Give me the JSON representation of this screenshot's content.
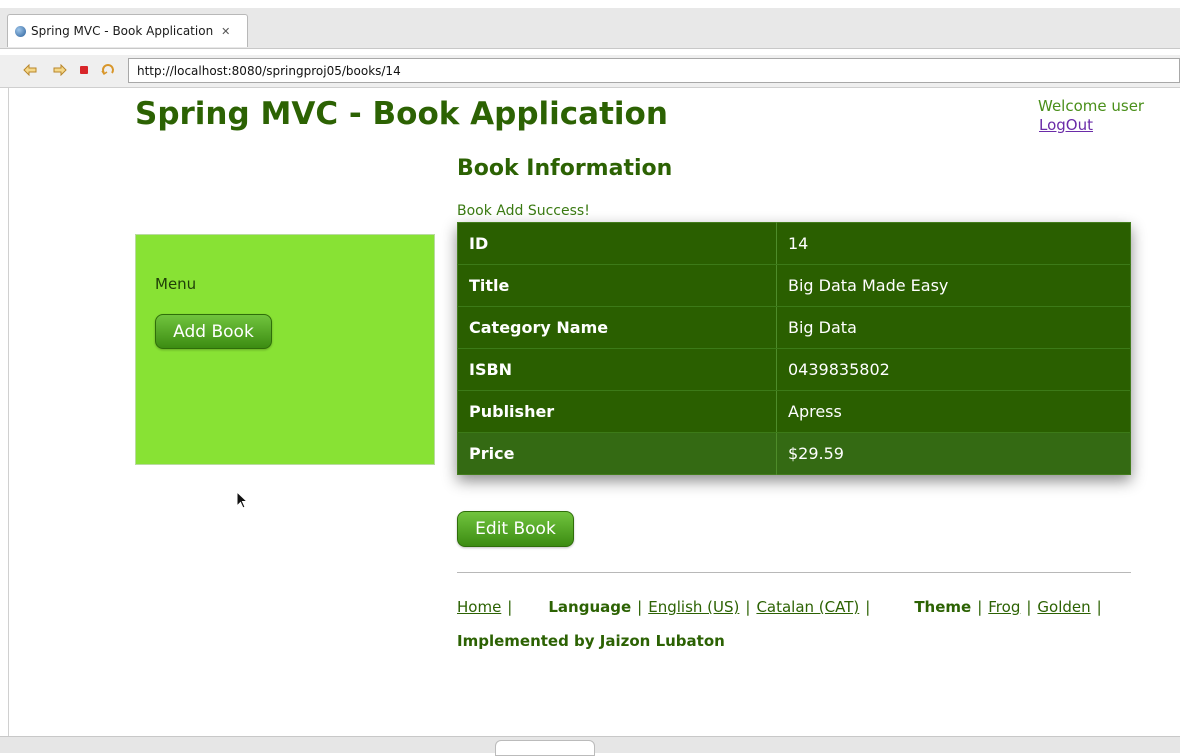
{
  "browser": {
    "tab_title": "Spring MVC - Book Application",
    "tab_close_icon": "✕",
    "url": "http://localhost:8080/springproj05/books/14",
    "nav_icons": [
      "back-arrow-icon",
      "forward-arrow-icon",
      "stop-icon",
      "refresh-icon"
    ]
  },
  "header": {
    "app_title": "Spring MVC - Book Application",
    "welcome": "Welcome user",
    "logout": "LogOut"
  },
  "menu": {
    "label": "Menu",
    "add_button": "Add Book"
  },
  "main": {
    "section_title": "Book Information",
    "success_message": "Book Add Success!",
    "rows": [
      {
        "key": "ID",
        "value": "14"
      },
      {
        "key": "Title",
        "value": "Big Data Made Easy"
      },
      {
        "key": "Category Name",
        "value": "Big Data"
      },
      {
        "key": "ISBN",
        "value": "0439835802"
      },
      {
        "key": "Publisher",
        "value": "Apress"
      },
      {
        "key": "Price",
        "value": "$29.59"
      }
    ],
    "edit_button": "Edit Book"
  },
  "footer": {
    "home": "Home",
    "language_label": "Language",
    "lang_en": "English (US)",
    "lang_ca": "Catalan (CAT)",
    "theme_label": "Theme",
    "theme_frog": "Frog",
    "theme_golden": "Golden",
    "implemented_by": "Implemented by Jaizon Lubaton",
    "separator": "|"
  },
  "colors": {
    "brand_green": "#2c6203",
    "menu_bg": "#88e234",
    "table_bg": "#2a5f00",
    "button_green": "#4a9c1a",
    "logout_link": "#6a2ba8"
  }
}
